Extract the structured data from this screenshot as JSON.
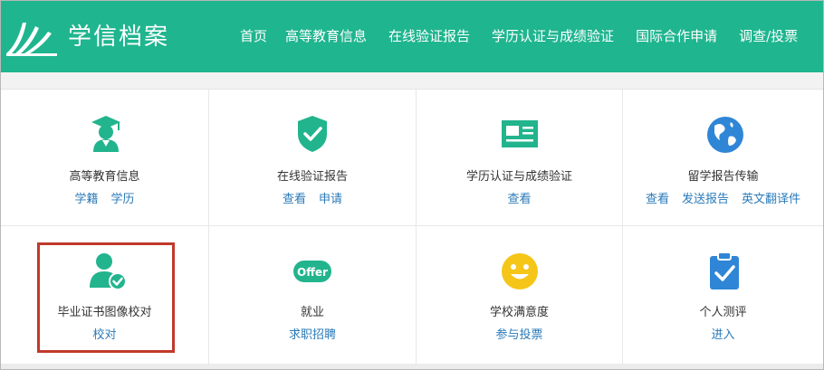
{
  "logo": {
    "text": "学信档案"
  },
  "nav": [
    "首页",
    "高等教育信息",
    "在线验证报告",
    "学历认证与成绩验证",
    "国际合作申请",
    "调查/投票"
  ],
  "tiles": [
    {
      "icon": "graduate-icon",
      "title": "高等教育信息",
      "links": [
        "学籍",
        "学历"
      ]
    },
    {
      "icon": "shield-check-icon",
      "title": "在线验证报告",
      "links": [
        "查看",
        "申请"
      ]
    },
    {
      "icon": "id-card-icon",
      "title": "学历认证与成绩验证",
      "links": [
        "查看"
      ]
    },
    {
      "icon": "globe-icon",
      "title": "留学报告传输",
      "links": [
        "查看",
        "发送报告",
        "英文翻译件"
      ]
    },
    {
      "icon": "user-check-icon",
      "title": "毕业证书图像校对",
      "links": [
        "校对"
      ]
    },
    {
      "icon": "offer-icon",
      "icon_text": "Offer",
      "title": "就业",
      "links": [
        "求职招聘"
      ]
    },
    {
      "icon": "smiley-icon",
      "title": "学校满意度",
      "links": [
        "参与投票"
      ]
    },
    {
      "icon": "clipboard-check-icon",
      "title": "个人测评",
      "links": [
        "进入"
      ]
    }
  ],
  "colors": {
    "header": "#1fb58f",
    "link": "#2a7ab8",
    "highlight": "#c0392b",
    "teal": "#22b48d",
    "blue": "#2f86d6",
    "yellow": "#f5c518"
  }
}
